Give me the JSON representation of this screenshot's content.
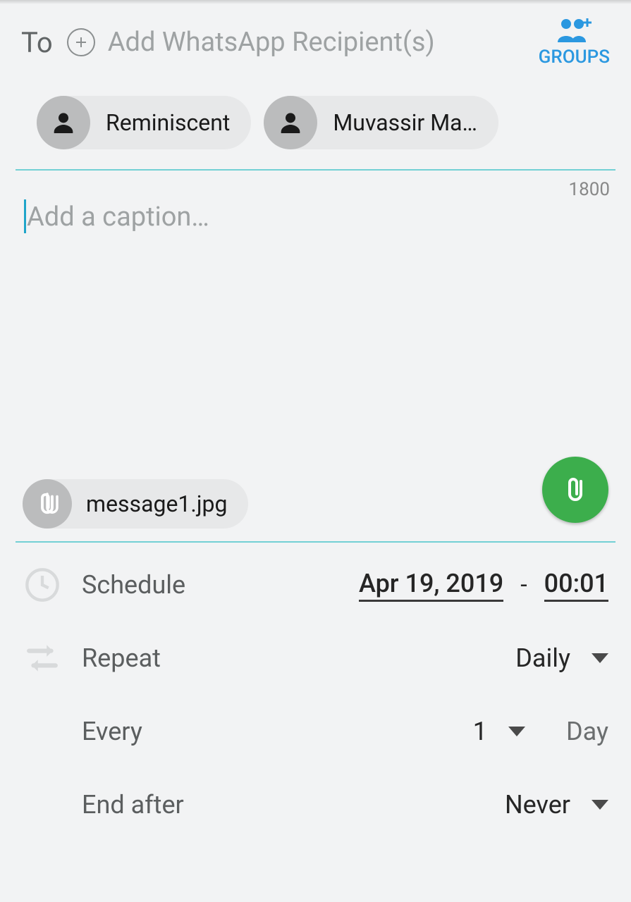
{
  "header": {
    "to_label": "To",
    "add_recipient_placeholder": "Add WhatsApp Recipient(s)",
    "groups_button": "GROUPS"
  },
  "recipients": [
    {
      "name": "Reminiscent"
    },
    {
      "name": "Muvassir Ma…"
    }
  ],
  "caption": {
    "placeholder": "Add a caption…",
    "char_count": "1800"
  },
  "attachment": {
    "filename": "message1.jpg"
  },
  "schedule": {
    "label": "Schedule",
    "date": "Apr 19, 2019",
    "time": "00:01"
  },
  "repeat": {
    "label": "Repeat",
    "value": "Daily"
  },
  "every": {
    "label": "Every",
    "count": "1",
    "unit": "Day"
  },
  "end_after": {
    "label": "End after",
    "value": "Never"
  }
}
